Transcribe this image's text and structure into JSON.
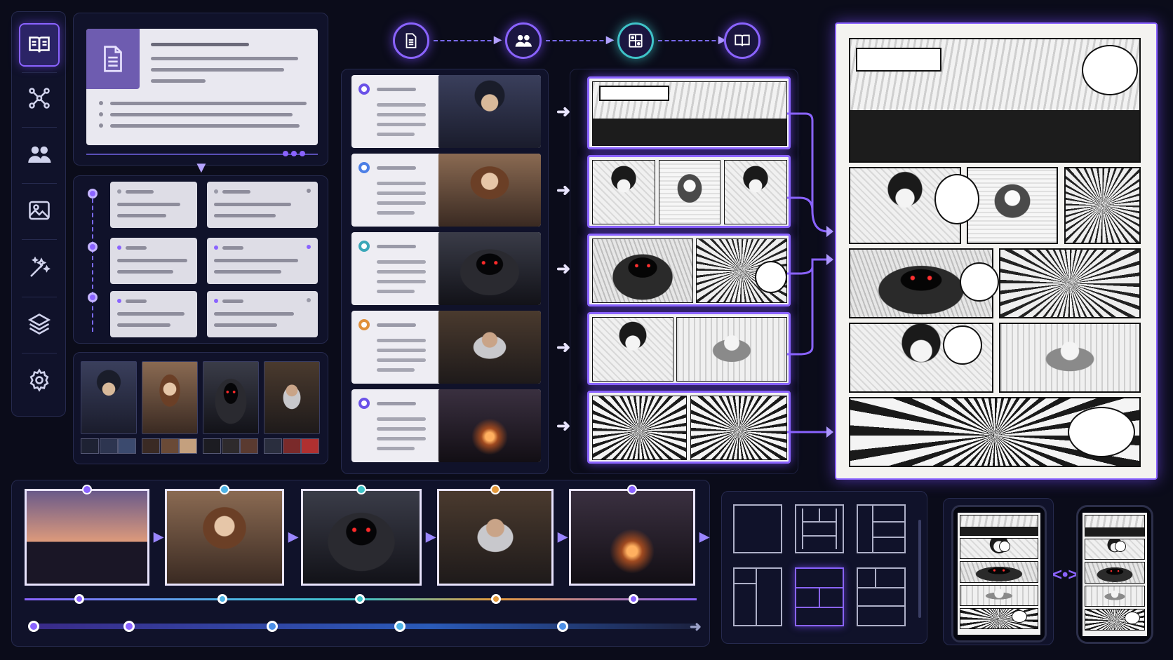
{
  "sidebar": {
    "items": [
      {
        "icon": "book-icon",
        "active": true
      },
      {
        "icon": "network-icon",
        "active": false
      },
      {
        "icon": "users-icon",
        "active": false
      },
      {
        "icon": "image-icon",
        "active": false
      },
      {
        "icon": "magic-wand-icon",
        "active": false
      },
      {
        "icon": "layers-icon",
        "active": false
      },
      {
        "icon": "gear-icon",
        "active": false
      }
    ]
  },
  "pipeline": {
    "steps": [
      {
        "icon": "document-icon"
      },
      {
        "icon": "users-icon"
      },
      {
        "icon": "layout-grid-icon"
      },
      {
        "icon": "book-icon"
      }
    ]
  },
  "characters": [
    {
      "name": "hero",
      "palette": [
        "#1e2233",
        "#2d3550",
        "#3b4a6e"
      ]
    },
    {
      "name": "heroine",
      "palette": [
        "#3a2a24",
        "#6a4a36",
        "#c4a07e"
      ]
    },
    {
      "name": "hooded-figure",
      "palette": [
        "#1c1c22",
        "#2e2a2c",
        "#5a3a30"
      ]
    },
    {
      "name": "elder-mage",
      "palette": [
        "#2a2e3e",
        "#7a2a2a",
        "#b03030"
      ]
    }
  ],
  "scene_ring_colors": [
    "#6b52e8",
    "#4c7fe6",
    "#3aa7b8",
    "#e0903a",
    "#6b52e8"
  ],
  "timeline": {
    "dot_colors": [
      "#8a63ff",
      "#4fb4e6",
      "#3fc3c8",
      "#e59a3c",
      "#8a63ff"
    ],
    "track_dot_colors": [
      "#8a63ff",
      "#8a63ff",
      "#4c8fe6",
      "#4fb4e6",
      "#4c8fe6"
    ]
  },
  "colors": {
    "accent": "#8a63ff",
    "background": "#0b0c1a",
    "panel": "#10122a"
  }
}
